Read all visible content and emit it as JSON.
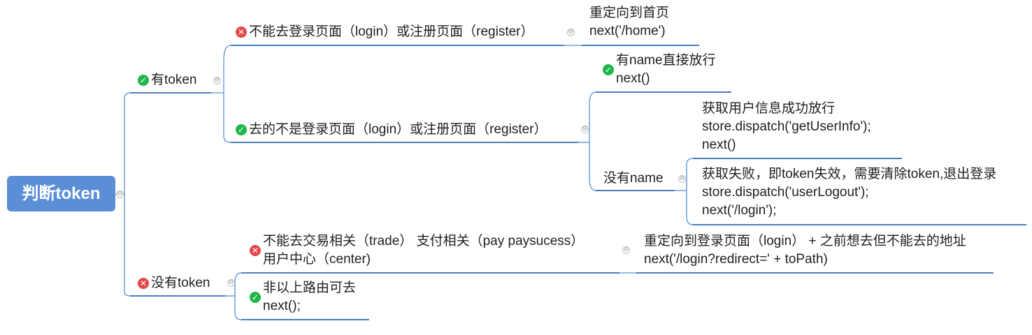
{
  "root": {
    "label": "判断token",
    "toggle": "⊖"
  },
  "branches": {
    "has_token": {
      "label": "有token",
      "icon": "check-icon",
      "login_register": {
        "label": "不能去登录页面（login）或注册页面（register）",
        "icon": "cross-icon",
        "child": {
          "lines": [
            "重定向到首页",
            "next('/home')"
          ]
        }
      },
      "not_login_register": {
        "label": "去的不是登录页面（login）或注册页面（register）",
        "icon": "check-icon",
        "has_name": {
          "lines": [
            "有name直接放行",
            "next()"
          ],
          "icon": "check-icon"
        },
        "no_name": {
          "label": "没有name",
          "success": {
            "lines": [
              "获取用户信息成功放行",
              "store.dispatch('getUserInfo');",
              "next()"
            ]
          },
          "fail": {
            "lines": [
              "获取失败，即token失效，需要清除token,退出登录",
              "store.dispatch('userLogout');",
              "next('/login');"
            ]
          }
        }
      }
    },
    "no_token": {
      "label": "没有token",
      "icon": "cross-icon",
      "restricted": {
        "lines": [
          "不能去交易相关（trade）  支付相关（pay paysucess）",
          "用户中心（center)"
        ],
        "icon": "cross-icon",
        "child": {
          "lines": [
            "重定向到登录页面（login） + 之前想去但不能去的地址",
            " next('/login?redirect=' + toPath)"
          ]
        }
      },
      "other": {
        "lines": [
          "非以上路由可去",
          "next();"
        ],
        "icon": "check-icon"
      }
    }
  },
  "colors": {
    "root_bg": "#5a8fd6",
    "connector": "#5a8fd6",
    "underline": "#4a7cc4",
    "ok": "#1fb64b",
    "no": "#e0484b"
  }
}
